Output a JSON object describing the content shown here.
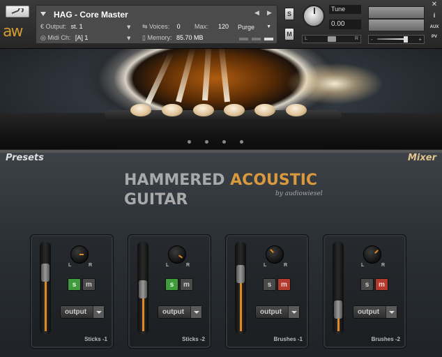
{
  "header": {
    "instrument_title": "HAG - Core Master",
    "output_label": "Output:",
    "output_value": "st. 1",
    "voices_label": "Voices:",
    "voices_value": "0",
    "max_label": "Max:",
    "max_value": "120",
    "purge_label": "Purge",
    "midi_label": "Midi Ch:",
    "midi_value": "[A]  1",
    "memory_label": "Memory:",
    "memory_value": "85.70 MB",
    "solo_label": "S",
    "mute_label": "M",
    "tune_label": "Tune",
    "tune_value": "0.00",
    "pan_left": "L",
    "pan_right": "R",
    "vol_minus": "-",
    "vol_plus": "+",
    "close_label": "✕",
    "aux_label": "AUX",
    "pv_label": "PV",
    "logo_text": "aw"
  },
  "panel": {
    "presets_label": "Presets",
    "mixer_label": "Mixer",
    "brand_word1": "HAMMERED",
    "brand_word2": "ACOUSTIC",
    "brand_word3": "GUITAR",
    "brand_byline": "by audiowiesel"
  },
  "channels": [
    {
      "name": "Sticks -1",
      "fader_level": 0.72,
      "solo": "s",
      "mute": "m",
      "solo_on": true,
      "mute_on": false,
      "output_label": "output"
    },
    {
      "name": "Sticks -2",
      "fader_level": 0.48,
      "solo": "s",
      "mute": "m",
      "solo_on": true,
      "mute_on": false,
      "output_label": "output"
    },
    {
      "name": "Brushes -1",
      "fader_level": 0.7,
      "solo": "s",
      "mute": "m",
      "solo_on": false,
      "mute_on": true,
      "output_label": "output"
    },
    {
      "name": "Brushes -2",
      "fader_level": 0.18,
      "solo": "s",
      "mute": "m",
      "solo_on": false,
      "mute_on": true,
      "output_label": "output"
    }
  ],
  "colors": {
    "accent_orange": "#e08a22",
    "brand_orange": "#d9993c",
    "solo_green": "#3f9b3b",
    "mute_red": "#b23b2e"
  }
}
